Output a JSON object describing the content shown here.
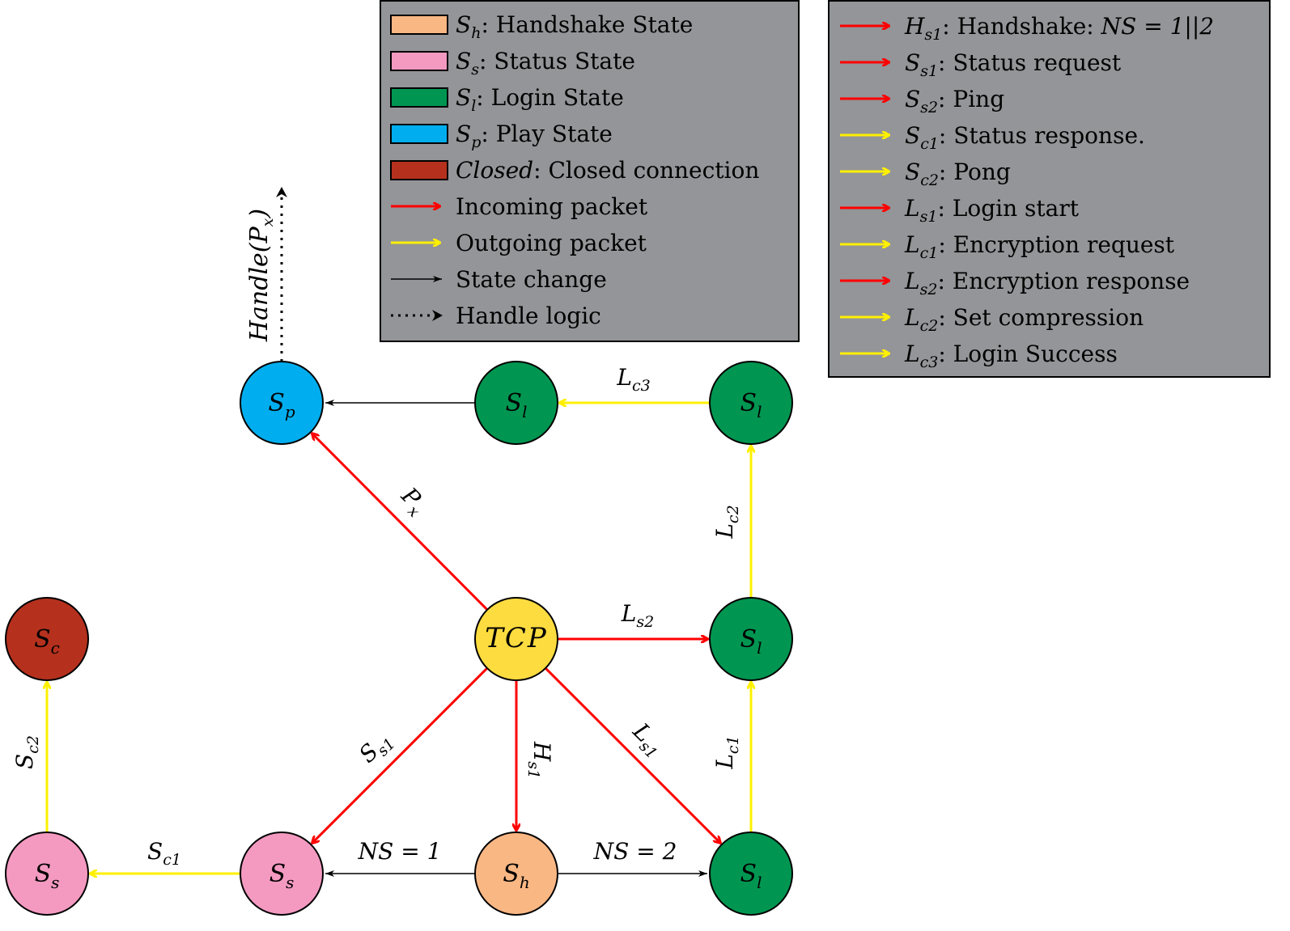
{
  "colors": {
    "handshake": "#F9B784",
    "status": "#F49AC1",
    "login": "#009651",
    "play": "#00AEEF",
    "closed": "#B5311E",
    "tcp": "#FDDC40",
    "incoming": "#FF0000",
    "outgoing": "#FFF000",
    "state_change": "#000000",
    "legend_bg": "#939598"
  },
  "legend_states": {
    "items": [
      {
        "symbol": "S",
        "sub": "h",
        "text": ": Handshake State",
        "color_key": "handshake",
        "kind": "box"
      },
      {
        "symbol": "S",
        "sub": "s",
        "text": ": Status State",
        "color_key": "status",
        "kind": "box"
      },
      {
        "symbol": "S",
        "sub": "l",
        "text": ": Login State",
        "color_key": "login",
        "kind": "box"
      },
      {
        "symbol": "S",
        "sub": "p",
        "text": ": Play State",
        "color_key": "play",
        "kind": "box"
      },
      {
        "symbol": "Closed",
        "sub": "",
        "text": ": Closed connection",
        "color_key": "closed",
        "kind": "box"
      },
      {
        "symbol": "",
        "sub": "",
        "text": "Incoming packet",
        "color_key": "incoming",
        "kind": "arrow"
      },
      {
        "symbol": "",
        "sub": "",
        "text": "Outgoing packet",
        "color_key": "outgoing",
        "kind": "arrow"
      },
      {
        "symbol": "",
        "sub": "",
        "text": "State change",
        "color_key": "state_change",
        "kind": "thin-arrow"
      },
      {
        "symbol": "",
        "sub": "",
        "text": "Handle logic",
        "color_key": "state_change",
        "kind": "dotted-arrow"
      }
    ]
  },
  "legend_packets": {
    "items": [
      {
        "symbol": "H",
        "sub": "s1",
        "text": ": Handshake: ",
        "extra": "NS = 1||2",
        "color_key": "incoming"
      },
      {
        "symbol": "S",
        "sub": "s1",
        "text": ": Status request",
        "extra": "",
        "color_key": "incoming"
      },
      {
        "symbol": "S",
        "sub": "s2",
        "text": ": Ping",
        "extra": "",
        "color_key": "incoming"
      },
      {
        "symbol": "S",
        "sub": "c1",
        "text": ": Status response.",
        "extra": "",
        "color_key": "outgoing"
      },
      {
        "symbol": "S",
        "sub": "c2",
        "text": ": Pong",
        "extra": "",
        "color_key": "outgoing"
      },
      {
        "symbol": "L",
        "sub": "s1",
        "text": ": Login start",
        "extra": "",
        "color_key": "incoming"
      },
      {
        "symbol": "L",
        "sub": "c1",
        "text": ": Encryption request",
        "extra": "",
        "color_key": "outgoing"
      },
      {
        "symbol": "L",
        "sub": "s2",
        "text": ": Encryption response",
        "extra": "",
        "color_key": "incoming"
      },
      {
        "symbol": "L",
        "sub": "c2",
        "text": ": Set compression",
        "extra": "",
        "color_key": "outgoing"
      },
      {
        "symbol": "L",
        "sub": "c3",
        "text": ": Login Success",
        "extra": "",
        "color_key": "outgoing"
      }
    ]
  },
  "nodes": [
    {
      "id": "sp",
      "symbol": "S",
      "sub": "p",
      "color_key": "play"
    },
    {
      "id": "sl_top_mid",
      "symbol": "S",
      "sub": "l",
      "color_key": "login"
    },
    {
      "id": "sl_top_right",
      "symbol": "S",
      "sub": "l",
      "color_key": "login"
    },
    {
      "id": "tcp",
      "symbol": "TCP",
      "sub": "",
      "color_key": "tcp"
    },
    {
      "id": "sl_mid",
      "symbol": "S",
      "sub": "l",
      "color_key": "login"
    },
    {
      "id": "sc",
      "symbol": "S",
      "sub": "c",
      "color_key": "closed"
    },
    {
      "id": "ss_left",
      "symbol": "S",
      "sub": "s",
      "color_key": "status"
    },
    {
      "id": "ss_mid",
      "symbol": "S",
      "sub": "s",
      "color_key": "status"
    },
    {
      "id": "sh",
      "symbol": "S",
      "sub": "h",
      "color_key": "handshake"
    },
    {
      "id": "sl_bottom",
      "symbol": "S",
      "sub": "l",
      "color_key": "login"
    }
  ],
  "edges": [
    {
      "from": "tcp",
      "to": "sp",
      "type": "incoming",
      "label": "P",
      "label_sub": "x"
    },
    {
      "from": "sl_top_mid",
      "to": "sp",
      "type": "state_change",
      "label": "",
      "label_sub": ""
    },
    {
      "from": "sl_top_right",
      "to": "sl_top_mid",
      "type": "outgoing",
      "label": "L",
      "label_sub": "c3"
    },
    {
      "from": "sl_mid",
      "to": "sl_top_right",
      "type": "outgoing",
      "label": "L",
      "label_sub": "c2"
    },
    {
      "from": "tcp",
      "to": "sl_mid",
      "type": "incoming",
      "label": "L",
      "label_sub": "s2"
    },
    {
      "from": "sl_bottom",
      "to": "sl_mid",
      "type": "outgoing",
      "label": "L",
      "label_sub": "c1"
    },
    {
      "from": "tcp",
      "to": "ss_mid",
      "type": "incoming",
      "label": "S",
      "label_sub": "s1"
    },
    {
      "from": "tcp",
      "to": "sh",
      "type": "incoming",
      "label": "H",
      "label_sub": "s1"
    },
    {
      "from": "tcp",
      "to": "sl_bottom",
      "type": "incoming",
      "label": "L",
      "label_sub": "s1"
    },
    {
      "from": "sh",
      "to": "ss_mid",
      "type": "state_change",
      "label": "NS = 1",
      "label_sub": ""
    },
    {
      "from": "sh",
      "to": "sl_bottom",
      "type": "state_change",
      "label": "NS = 2",
      "label_sub": ""
    },
    {
      "from": "ss_mid",
      "to": "ss_left",
      "type": "outgoing",
      "label": "S",
      "label_sub": "c1"
    },
    {
      "from": "ss_left",
      "to": "sc",
      "type": "outgoing",
      "label": "S",
      "label_sub": "c2"
    }
  ],
  "handle": {
    "label": "Handle(P",
    "label_sub": "x",
    "label_tail": ")"
  }
}
